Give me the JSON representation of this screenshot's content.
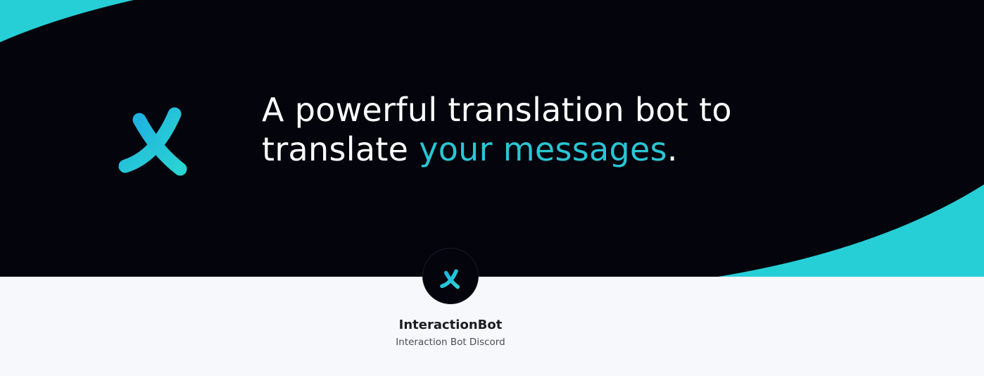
{
  "banner": {
    "tagline_part1": "A powerful translation bot to",
    "tagline_part2": "translate ",
    "tagline_accent": "your messages",
    "tagline_end": ".",
    "logo_icon": "translate-icon",
    "accent_color": "#29c6d4",
    "background_color": "#03040c"
  },
  "profile": {
    "avatar_icon": "translate-icon",
    "name": "InteractionBot",
    "description": "Interaction Bot Discord"
  }
}
